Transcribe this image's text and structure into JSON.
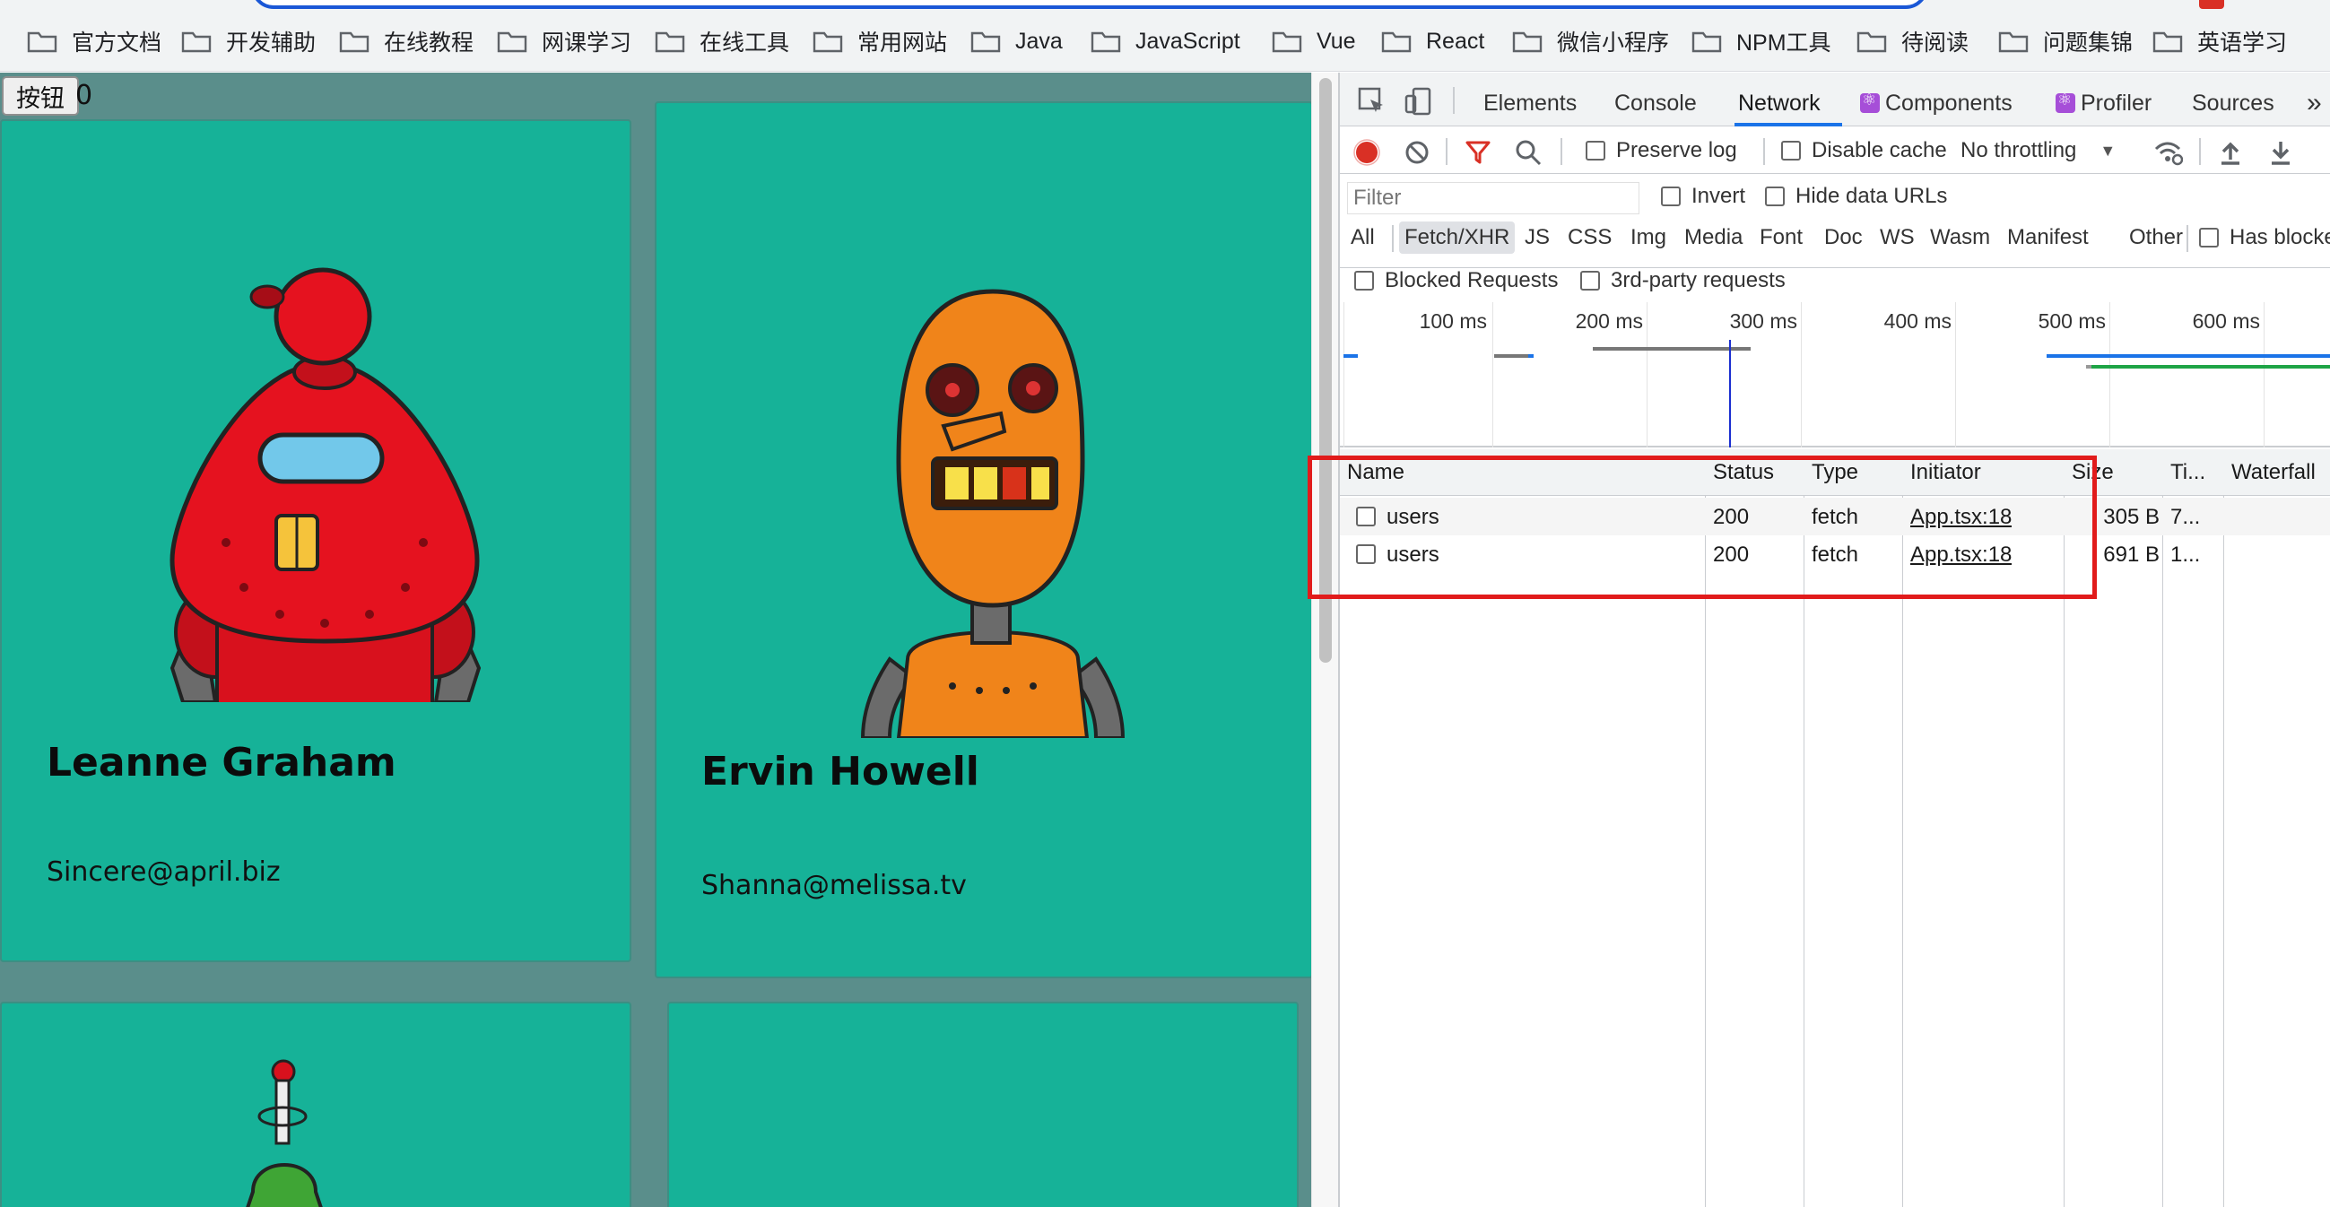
{
  "bookmarks": [
    {
      "label": "官方文档"
    },
    {
      "label": "开发辅助"
    },
    {
      "label": "在线教程"
    },
    {
      "label": "网课学习"
    },
    {
      "label": "在线工具"
    },
    {
      "label": "常用网站"
    },
    {
      "label": "Java"
    },
    {
      "label": "JavaScript"
    },
    {
      "label": "Vue"
    },
    {
      "label": "React"
    },
    {
      "label": "微信小程序"
    },
    {
      "label": "NPM工具"
    },
    {
      "label": "待阅读"
    },
    {
      "label": "问题集锦"
    },
    {
      "label": "英语学习"
    }
  ],
  "page": {
    "button_label": "按钮",
    "counter": "0",
    "cards": [
      {
        "name": "Leanne Graham",
        "email": "Sincere@april.biz",
        "robot_color": "#e5121f"
      },
      {
        "name": "Ervin Howell",
        "email": "Shanna@melissa.tv",
        "robot_color": "#f0841a"
      }
    ]
  },
  "devtools": {
    "tabs": [
      {
        "label": "Elements"
      },
      {
        "label": "Console"
      },
      {
        "label": "Network"
      },
      {
        "label": "Components"
      },
      {
        "label": "Profiler"
      },
      {
        "label": "Sources"
      }
    ],
    "active_tab": "Network",
    "more_tabs_glyph": "»",
    "toolbar": {
      "preserve_log": "Preserve log",
      "disable_cache": "Disable cache",
      "throttling": "No throttling"
    },
    "filter": {
      "placeholder": "Filter",
      "invert": "Invert",
      "hide_data_urls": "Hide data URLs",
      "types": [
        "All",
        "Fetch/XHR",
        "JS",
        "CSS",
        "Img",
        "Media",
        "Font",
        "Doc",
        "WS",
        "Wasm",
        "Manifest",
        "Other"
      ],
      "active_type": "Fetch/XHR",
      "has_blocked": "Has blocke",
      "blocked_requests": "Blocked Requests",
      "third_party": "3rd-party requests"
    },
    "overview_ticks": [
      "100 ms",
      "200 ms",
      "300 ms",
      "400 ms",
      "500 ms",
      "600 ms"
    ],
    "table": {
      "columns": [
        "Name",
        "Status",
        "Type",
        "Initiator",
        "Size",
        "Ti...",
        "Waterfall"
      ],
      "rows": [
        {
          "name": "users",
          "status": "200",
          "type": "fetch",
          "initiator": "App.tsx:18",
          "size": "305 B",
          "time": "7..."
        },
        {
          "name": "users",
          "status": "200",
          "type": "fetch",
          "initiator": "App.tsx:18",
          "size": "691 B",
          "time": "1..."
        }
      ]
    }
  },
  "colors": {
    "card_bg": "#16b298",
    "page_bg": "#5a8e8b",
    "highlight": "#e11b1b",
    "record": "#d93025",
    "accent": "#1a73e8"
  }
}
